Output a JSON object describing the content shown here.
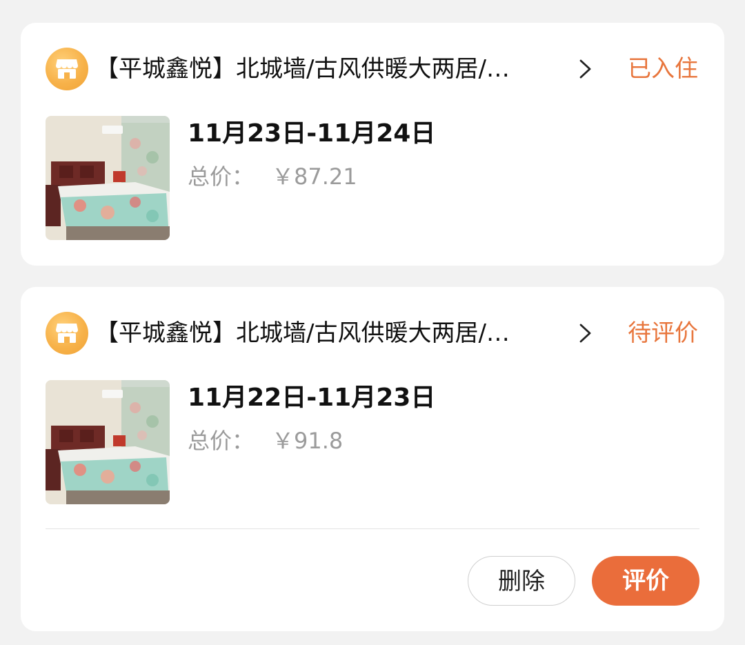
{
  "orders": [
    {
      "hotel_title": "【平城鑫悦】北城墙/古风供暖大两居/…",
      "status": "已入住",
      "dates": "11月23日-11月24日",
      "price_label": "总价：",
      "price": "￥87.21"
    },
    {
      "hotel_title": "【平城鑫悦】北城墙/古风供暖大两居/…",
      "status": "待评价",
      "dates": "11月22日-11月23日",
      "price_label": "总价：",
      "price": "￥91.8",
      "actions": {
        "delete_label": "删除",
        "review_label": "评价"
      }
    }
  ],
  "icons": {
    "shop": "shop-icon",
    "chevron": "chevron-right-icon"
  },
  "colors": {
    "status": "#e8763d",
    "primary_button": "#ea6d3b",
    "shop_badge": "#f7b24a"
  }
}
